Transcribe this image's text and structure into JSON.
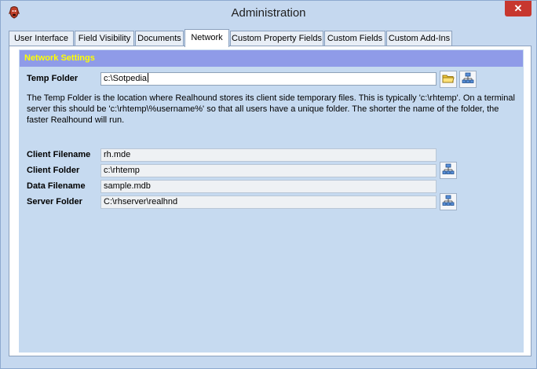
{
  "window": {
    "title": "Administration",
    "close_glyph": "✕"
  },
  "tabs": [
    {
      "label": "User Interface",
      "active": false
    },
    {
      "label": "Field Visibility",
      "active": false
    },
    {
      "label": "Documents",
      "active": false
    },
    {
      "label": "Network",
      "active": true
    },
    {
      "label": "Custom Property Fields",
      "active": false
    },
    {
      "label": "Custom Fields",
      "active": false
    },
    {
      "label": "Custom Add-Ins",
      "active": false
    }
  ],
  "network": {
    "section_title": "Network Settings",
    "temp_folder": {
      "label": "Temp Folder",
      "value": "c:\\Sotpedia"
    },
    "description": "The Temp Folder is the location where Realhound stores its client side temporary files.  This is typically 'c:\\rhtemp'.  On a terminal server this should be 'c:\\rhtemp\\%username%' so that all users have a unique folder.  The shorter the name of the folder, the faster Realhound will run.",
    "client_filename": {
      "label": "Client Filename",
      "value": "rh.mde"
    },
    "client_folder": {
      "label": "Client Folder",
      "value": "c:\\rhtemp"
    },
    "data_filename": {
      "label": "Data Filename",
      "value": "sample.mdb"
    },
    "server_folder": {
      "label": "Server Folder",
      "value": "C:\\rhserver\\realhnd"
    }
  },
  "icons": {
    "app": "hound-app-icon",
    "browse": "folder-icon",
    "network": "network-icon"
  },
  "colors": {
    "section_header_bg": "#8f9be8",
    "section_header_text": "#ffff00",
    "close_button": "#c7372f"
  }
}
